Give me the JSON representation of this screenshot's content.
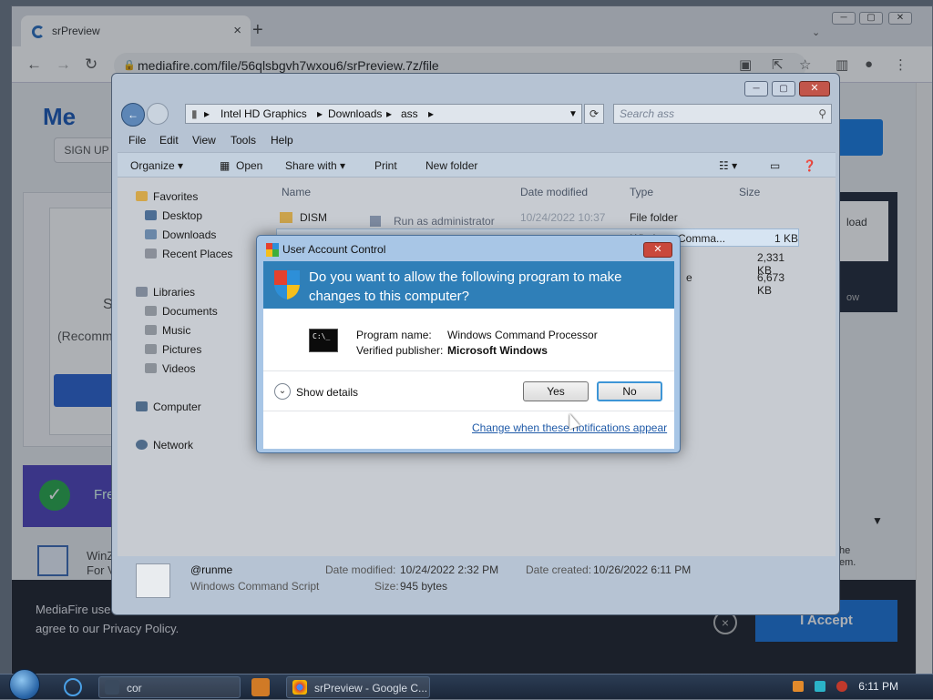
{
  "browser": {
    "tab_title": "srPreview",
    "tab_close": "×",
    "new_tab": "+",
    "url": "mediafire.com/file/56qlsbgvh7wxou6/srPreview.7z/file",
    "window_buttons": [
      "─",
      "▢",
      "✕"
    ],
    "nav": {
      "back": "←",
      "forward": "→",
      "reload": "↻"
    },
    "toolbar_icons": [
      "cast-icon",
      "share-icon",
      "star-icon",
      "sidepanel-icon",
      "profile-icon",
      "menu-icon"
    ]
  },
  "mediafire": {
    "logo": "Me",
    "signup": "SIGN UP",
    "recommend": "(Recomm",
    "side_letter": "S",
    "free_text": "Free",
    "winz_text": [
      "WinZ",
      "For V"
    ],
    "download_partial": "load",
    "dark_panel_bottom": "ow",
    "side_text": [
      "he",
      "em."
    ],
    "cookie_text": [
      "MediaFire use",
      "agree to our Privacy Policy."
    ],
    "cookie_close": "×",
    "accept": "I Accept"
  },
  "explorer": {
    "breadcrumbs": [
      "Intel HD Graphics",
      "Downloads",
      "ass"
    ],
    "search_placeholder": "Search ass",
    "menu": [
      "File",
      "Edit",
      "View",
      "Tools",
      "Help"
    ],
    "toolbar": {
      "organize": "Organize ▾",
      "open": "Open",
      "share_with": "Share with ▾",
      "print": "Print",
      "new_folder": "New folder"
    },
    "nav": {
      "favorites": "Favorites",
      "desktop": "Desktop",
      "downloads": "Downloads",
      "recent": "Recent Places",
      "libraries": "Libraries",
      "documents": "Documents",
      "music": "Music",
      "pictures": "Pictures",
      "videos": "Videos",
      "computer": "Computer",
      "network": "Network"
    },
    "columns": {
      "name": "Name",
      "date": "Date modified",
      "type": "Type",
      "size": "Size"
    },
    "files": [
      {
        "name": "DISM",
        "date": "10/24/2022 10:37",
        "type": "File folder",
        "size": ""
      },
      {
        "name": "@runme",
        "date": "",
        "type": "Windows Comma...",
        "size": "1 KB"
      },
      {
        "name": "",
        "date": "",
        "type": "",
        "size": "2,331 KB"
      },
      {
        "name": "",
        "date": "",
        "type": "e",
        "size": "6,673 KB"
      }
    ],
    "ghost_menu": "Run as administrator",
    "details": {
      "name": "@runme",
      "type": "Windows Command Script",
      "modified_label": "Date modified:",
      "modified": "10/24/2022 2:32 PM",
      "created_label": "Date created:",
      "created": "10/26/2022 6:11 PM",
      "size_label": "Size:",
      "size": "945 bytes"
    }
  },
  "uac": {
    "title": "User Account Control",
    "close": "✕",
    "question_line1": "Do you want to allow the following program to make",
    "question_line2": "changes to this computer?",
    "program_label": "Program name:",
    "program_value": "Windows Command Processor",
    "publisher_label": "Verified publisher:",
    "publisher_value": "Microsoft Windows",
    "show_details": "Show details",
    "yes": "Yes",
    "no": "No",
    "change_link": "Change when these notifications appear",
    "cmd_icon_text": "C:\\_"
  },
  "taskbar": {
    "apps": [
      "cor",
      "srPreview - Google C..."
    ],
    "clock": "6:11 PM"
  }
}
